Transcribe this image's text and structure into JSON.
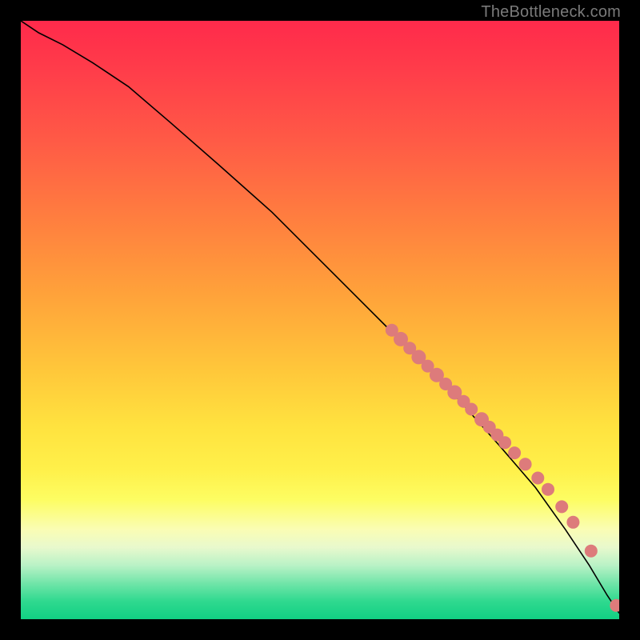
{
  "watermark": "TheBottleneck.com",
  "chart_data": {
    "type": "line",
    "title": "",
    "xlabel": "",
    "ylabel": "",
    "xlim": [
      0,
      100
    ],
    "ylim": [
      0,
      100
    ],
    "grid": false,
    "series": [
      {
        "name": "curve",
        "x": [
          0,
          3,
          7,
          12,
          18,
          25,
          33,
          42,
          52,
          62,
          72,
          80,
          86,
          91,
          95,
          98,
          100
        ],
        "y": [
          100,
          98,
          96,
          93,
          89,
          83,
          76,
          68,
          58,
          48,
          38,
          29,
          22,
          15,
          9,
          4,
          1
        ]
      }
    ],
    "points": {
      "name": "markers",
      "x": [
        62,
        63.5,
        65,
        66.5,
        68,
        69.5,
        71,
        72.5,
        74,
        75.3,
        77,
        78.3,
        79.6,
        80.9,
        82.5,
        84.3,
        86.4,
        88.1,
        90.4,
        92.3,
        95.3,
        99.5
      ],
      "y": [
        48.3,
        46.8,
        45.3,
        43.8,
        42.3,
        40.8,
        39.3,
        37.9,
        36.4,
        35.1,
        33.4,
        32.1,
        30.8,
        29.5,
        27.8,
        25.9,
        23.6,
        21.7,
        18.8,
        16.2,
        11.4,
        2.3
      ],
      "r": [
        8,
        9,
        8,
        9,
        8,
        9,
        8,
        9,
        8,
        8,
        9,
        8,
        8,
        8,
        8,
        8,
        8,
        8,
        8,
        8,
        8,
        8
      ]
    }
  }
}
